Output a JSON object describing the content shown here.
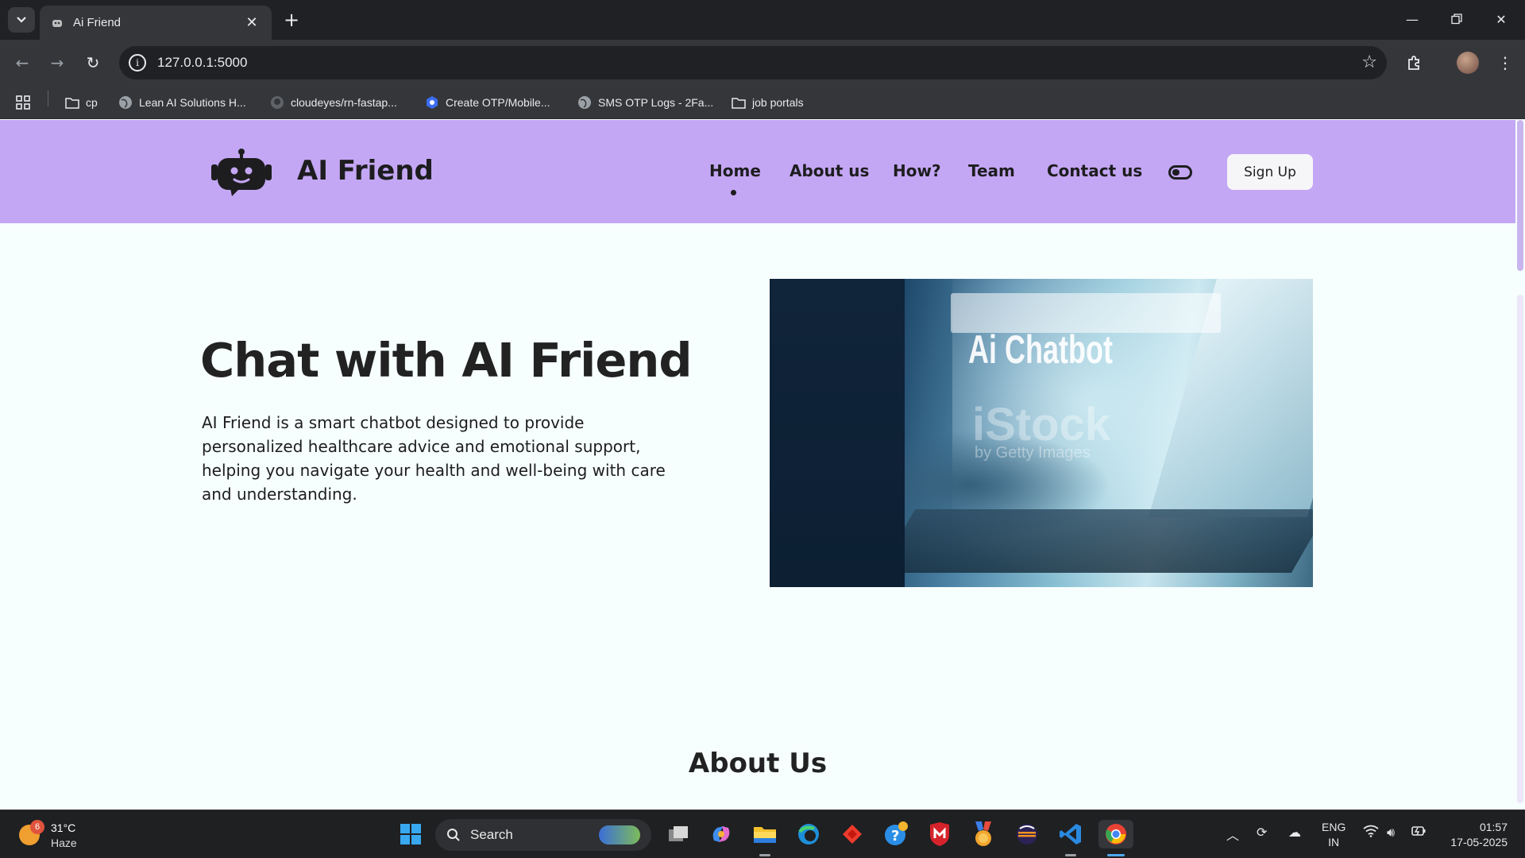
{
  "browser": {
    "tab_title": "Ai Friend",
    "new_tab_label": "+",
    "url": "127.0.0.1:5000",
    "bookmarks": [
      {
        "label": "cp",
        "icon": "folder-icon"
      },
      {
        "label": "Lean AI Solutions H...",
        "icon": "globe-icon"
      },
      {
        "label": "cloudeyes/rn-fastap...",
        "icon": "github-icon"
      },
      {
        "label": "Create OTP/Mobile...",
        "icon": "app-icon"
      },
      {
        "label": "SMS OTP Logs - 2Fa...",
        "icon": "globe-icon"
      },
      {
        "label": "job portals",
        "icon": "folder-icon"
      }
    ]
  },
  "site": {
    "brand": "AI Friend",
    "nav": [
      {
        "label": "Home",
        "active": true
      },
      {
        "label": "About us"
      },
      {
        "label": "How?"
      },
      {
        "label": "Team"
      },
      {
        "label": "Contact us"
      }
    ],
    "signup_label": "Sign Up",
    "colors": {
      "header": "#c4a7f4",
      "background": "#f6fefe",
      "text": "#1d1d1f"
    }
  },
  "hero": {
    "title": "Chat with AI Friend",
    "description": "AI Friend is a smart chatbot designed to provide personalized healthcare advice and emotional support, helping you navigate your health and well-being with care and understanding.",
    "image_text": "Ai Chatbot",
    "watermark": "iStock",
    "watermark_sub": "by Getty Images"
  },
  "about": {
    "title": "About Us"
  },
  "taskbar": {
    "weather_temp": "31°C",
    "weather_cond": "Haze",
    "weather_badge": "6",
    "search_label": "Search",
    "lang_top": "ENG",
    "lang_bottom": "IN",
    "time": "01:57",
    "date": "17-05-2025"
  }
}
